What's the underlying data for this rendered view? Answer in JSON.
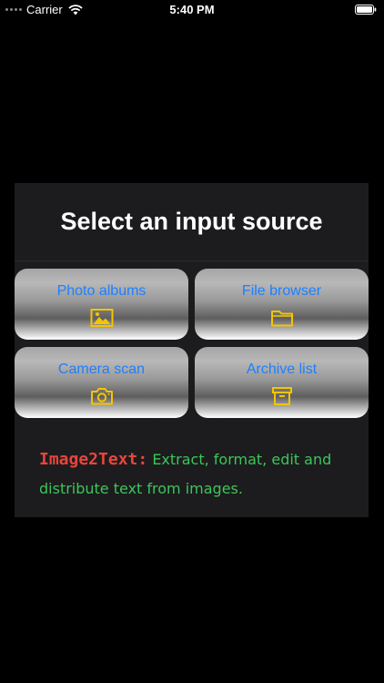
{
  "status_bar": {
    "carrier": "Carrier",
    "time": "5:40 PM"
  },
  "dialog": {
    "title": "Select an input source",
    "buttons": [
      {
        "label": "Photo albums",
        "icon": "photo-icon"
      },
      {
        "label": "File browser",
        "icon": "folder-icon"
      },
      {
        "label": "Camera scan",
        "icon": "camera-icon"
      },
      {
        "label": "Archive list",
        "icon": "archive-icon"
      }
    ],
    "tagline": {
      "brand": "Image2Text:",
      "text": "Extract, format, edit and distribute text from images."
    }
  },
  "colors": {
    "background": "#000000",
    "panel": "#1c1c1e",
    "button_label": "#1d7fff",
    "icon": "#f5c400",
    "brand": "#e8453c",
    "tagline": "#3cc55a"
  }
}
